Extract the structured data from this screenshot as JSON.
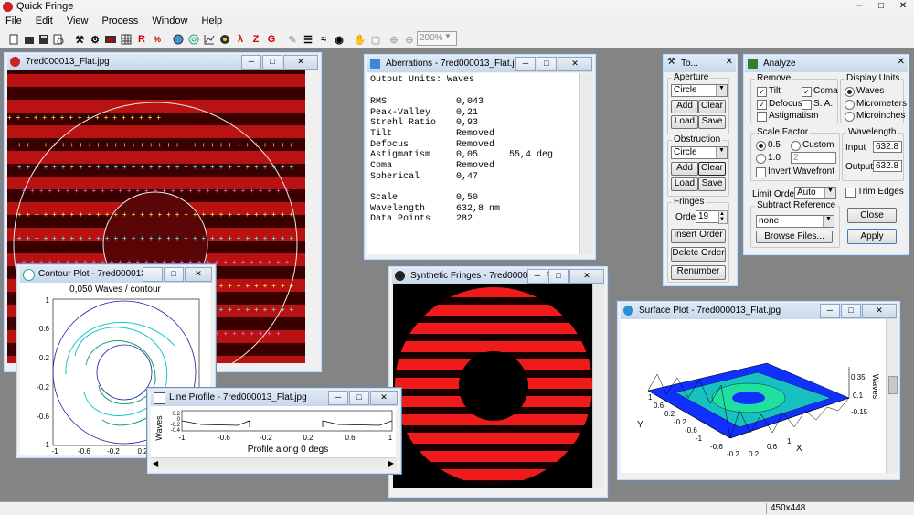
{
  "app": {
    "title": "Quick Fringe",
    "menus": [
      "File",
      "Edit",
      "View",
      "Process",
      "Window",
      "Help"
    ],
    "zoom": "200%",
    "status_size": "450x448"
  },
  "toolbar_icons": [
    "new-icon",
    "open-icon",
    "save-icon",
    "print-icon",
    "print-preview-icon",
    "tools-icon",
    "settings-icon",
    "grid-icon",
    "fringe-icon",
    "center-icon",
    "r-icon",
    "percent-icon",
    "globe-icon",
    "contour-icon",
    "plot-icon",
    "surface-icon",
    "wavelength-icon",
    "z-icon",
    "g-icon",
    "edit-icon",
    "fringe-trace-icon",
    "wifi-icon",
    "fan-icon",
    "hand-icon",
    "select-icon",
    "zoom-in-icon",
    "zoom-out-icon"
  ],
  "interferogram": {
    "title": "7red000013_Flat.jpg"
  },
  "aberrations": {
    "title": "Aberrations - 7red000013_Flat.jpg",
    "units_line": "Output Units: Waves",
    "rows": [
      {
        "label": "RMS",
        "value": "0,043",
        "extra": ""
      },
      {
        "label": "Peak-Valley",
        "value": "0,21",
        "extra": ""
      },
      {
        "label": "Strehl Ratio",
        "value": "0,93",
        "extra": ""
      },
      {
        "label": "Tilt",
        "value": "Removed",
        "extra": ""
      },
      {
        "label": "Defocus",
        "value": "Removed",
        "extra": ""
      },
      {
        "label": "Astigmatism",
        "value": "0,05",
        "extra": "55,4 deg"
      },
      {
        "label": "Coma",
        "value": "Removed",
        "extra": ""
      },
      {
        "label": "Spherical",
        "value": "0,47",
        "extra": ""
      }
    ],
    "rows2": [
      {
        "label": "Scale",
        "value": "0,50"
      },
      {
        "label": "Wavelength",
        "value": "632,8 nm"
      },
      {
        "label": "Data Points",
        "value": "282"
      }
    ]
  },
  "tools": {
    "title": "To...",
    "aperture_label": "Aperture",
    "aperture_value": "Circle",
    "aperture_add": "Add",
    "aperture_clear": "Clear",
    "aperture_load": "Load",
    "aperture_save": "Save",
    "obstruction_label": "Obstruction",
    "obstruction_value": "Circle",
    "obstruction_add": "Add",
    "obstruction_clear": "Clear",
    "obstruction_load": "Load",
    "obstruction_save": "Save",
    "fringes_label": "Fringes",
    "order_label": "Order",
    "order_value": "19",
    "insert_order": "Insert Order",
    "delete_order": "Delete Order",
    "renumber": "Renumber"
  },
  "analyze": {
    "title": "Analyze",
    "remove_label": "Remove",
    "tilt": "Tilt",
    "coma": "Coma",
    "defocus": "Defocus",
    "sa": "S. A.",
    "astigmatism": "Astigmatism",
    "display_units_label": "Display Units",
    "units": [
      "Waves",
      "Micrometers",
      "Microinches"
    ],
    "scale_factor_label": "Scale Factor",
    "scale_05": "0.5",
    "scale_custom": "Custom",
    "scale_10": "1.0",
    "custom_value": "2",
    "invert": "Invert Wavefront",
    "wavelength_label": "Wavelength",
    "input_label": "Input",
    "input_value": "632.8",
    "output_label": "Output",
    "output_value": "632.8",
    "limit_order_label": "Limit Order",
    "limit_order_value": "Auto",
    "trim_edges": "Trim Edges",
    "subtract_label": "Subtract Reference",
    "subtract_value": "none",
    "browse": "Browse Files...",
    "close": "Close",
    "apply": "Apply"
  },
  "contour": {
    "title": "Contour Plot - 7red000013_F...",
    "subtitle": "0,050 Waves / contour",
    "yticks": [
      "1",
      "0.6",
      "0.2",
      "-0.2",
      "-0.6",
      "-1"
    ],
    "xticks": [
      "-1",
      "-0.6",
      "-0.2",
      "0.2"
    ]
  },
  "synthetic": {
    "title": "Synthetic Fringes - 7red000013_Flat..."
  },
  "surface": {
    "title": "Surface Plot - 7red000013_Flat.jpg",
    "zlabel": "Waves",
    "zticks": [
      "0.35",
      "0.1",
      "-0.15"
    ],
    "ylabel": "Y",
    "xlabel": "X",
    "yticks": [
      "1",
      "0.6",
      "0.2",
      "-0.2",
      "-0.6",
      "-1"
    ],
    "xticks": [
      "-0.6",
      "-0.2",
      "0.2",
      "0.6",
      "1"
    ],
    "xticks_left": [
      "-0.6",
      "-0.2",
      "0.2",
      "0.6",
      "1"
    ]
  },
  "line_profile": {
    "title": "Line Profile - 7red000013_Flat.jpg",
    "ylabel": "Waves",
    "yticks": [
      "0.2",
      "0",
      "-0.2",
      "-0.4"
    ],
    "xticks": [
      "-1",
      "-0.6",
      "-0.2",
      "0.2",
      "0.6",
      "1"
    ],
    "caption": "Profile along 0 degs"
  }
}
